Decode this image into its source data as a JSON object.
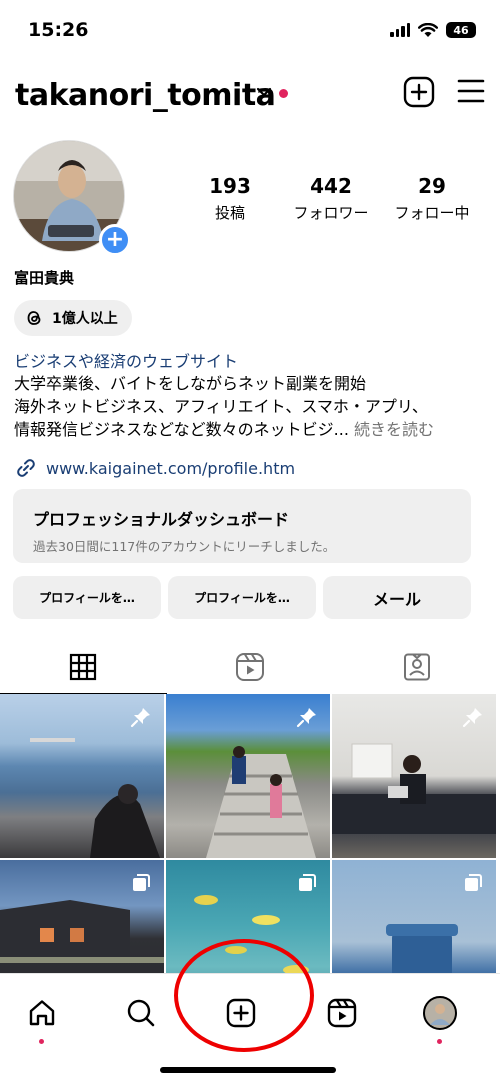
{
  "status": {
    "time": "15:26",
    "battery": "46"
  },
  "header": {
    "username": "takanori_tomita"
  },
  "profile": {
    "stats": [
      {
        "num": "193",
        "label": "投稿"
      },
      {
        "num": "442",
        "label": "フォロワー"
      },
      {
        "num": "29",
        "label": "フォロー中"
      }
    ],
    "full_name": "富田貴典",
    "threads_badge": "1億人以上",
    "category": "ビジネスや経済のウェブサイト",
    "bio_lines": [
      "大学卒業後、バイトをしながらネット副業を開始",
      "海外ネットビジネス、アフィリエイト、スマホ・アプリ、",
      "情報発信ビジネスなどなど数々のネットビジ..."
    ],
    "bio_more": "続きを読む",
    "link": "www.kaigainet.com/profile.htm"
  },
  "dashboard": {
    "title": "プロフェッショナルダッシュボード",
    "subtitle": "過去30日間に117件のアカウントにリーチしました。"
  },
  "buttons": [
    "プロフィールを…",
    "プロフィールを…",
    "メール"
  ],
  "tabs": [
    "grid-icon",
    "reels-icon",
    "tagged-icon"
  ],
  "grid_posts": [
    {
      "icon": "pin-icon"
    },
    {
      "icon": "pin-icon"
    },
    {
      "icon": "pin-icon"
    },
    {
      "icon": "carousel-icon"
    },
    {
      "icon": "carousel-icon"
    },
    {
      "icon": "carousel-icon"
    }
  ],
  "bottom_nav": [
    "home-icon",
    "search-icon",
    "create-icon",
    "reels-icon",
    "profile-avatar"
  ],
  "colors": {
    "accent": "#3f8ef5",
    "link": "#1a3e74",
    "notification": "#e0245e",
    "annotation": "#ee0000"
  }
}
